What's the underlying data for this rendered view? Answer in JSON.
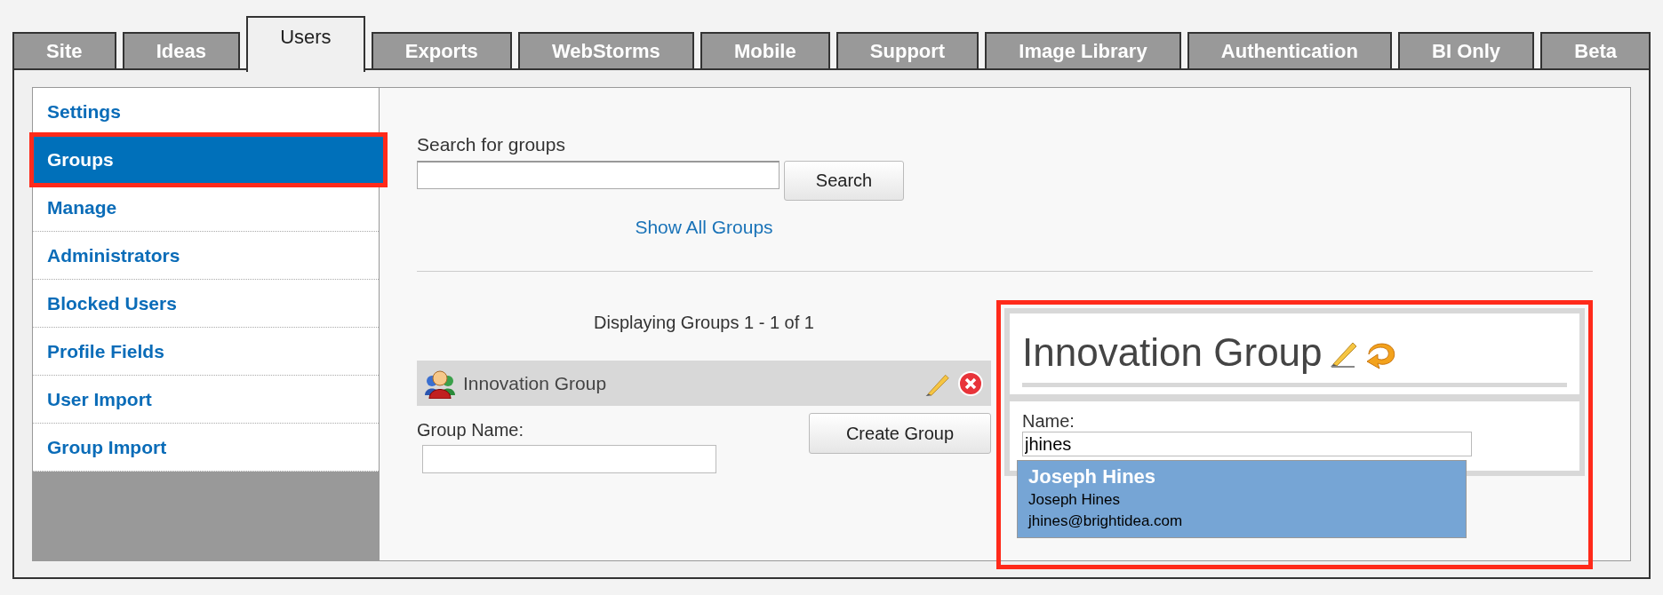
{
  "tabs": [
    {
      "label": "Site",
      "selected": false
    },
    {
      "label": "Ideas",
      "selected": false
    },
    {
      "label": "Users",
      "selected": true
    },
    {
      "label": "Exports",
      "selected": false
    },
    {
      "label": "WebStorms",
      "selected": false
    },
    {
      "label": "Mobile",
      "selected": false
    },
    {
      "label": "Support",
      "selected": false
    },
    {
      "label": "Image Library",
      "selected": false
    },
    {
      "label": "Authentication",
      "selected": false
    },
    {
      "label": "BI Only",
      "selected": false
    },
    {
      "label": "Beta",
      "selected": false
    }
  ],
  "sidebar": {
    "items": [
      {
        "label": "Settings",
        "selected": false
      },
      {
        "label": "Groups",
        "selected": true
      },
      {
        "label": "Manage",
        "selected": false
      },
      {
        "label": "Administrators",
        "selected": false
      },
      {
        "label": "Blocked Users",
        "selected": false
      },
      {
        "label": "Profile Fields",
        "selected": false
      },
      {
        "label": "User Import",
        "selected": false
      },
      {
        "label": "Group Import",
        "selected": false
      }
    ]
  },
  "search": {
    "label": "Search for groups",
    "button": "Search",
    "show_all_link": "Show All Groups"
  },
  "results_summary": "Displaying Groups 1 - 1 of 1",
  "groups": [
    {
      "name": "Innovation Group"
    }
  ],
  "create": {
    "label": "Group Name:",
    "button": "Create Group"
  },
  "group_detail": {
    "title": "Innovation Group",
    "name_label": "Name:",
    "name_value": "jhines",
    "suggestions": [
      {
        "title": "Joseph Hines",
        "name": "Joseph Hines",
        "email": "jhines@brightidea.com"
      }
    ]
  }
}
